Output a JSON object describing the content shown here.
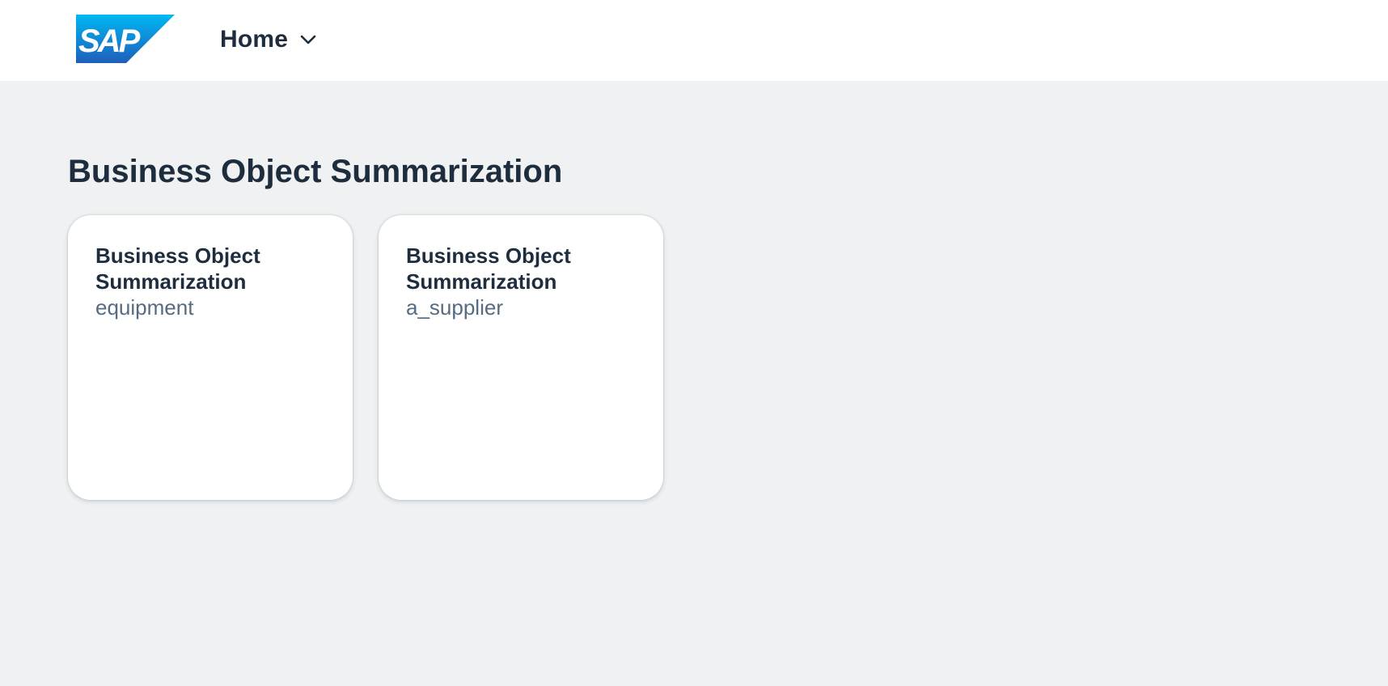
{
  "header": {
    "logo_text": "SAP",
    "menu_label": "Home",
    "menu_icon": "chevron-down-icon"
  },
  "main": {
    "section_title": "Business Object Summarization",
    "tiles": [
      {
        "title": "Business Object Summarization",
        "subtitle": "equipment"
      },
      {
        "title": "Business Object Summarization",
        "subtitle": "a_supplier"
      }
    ]
  },
  "colors": {
    "background": "#eff1f2",
    "header": "#ffffff",
    "text_primary": "#1d2d3e",
    "text_secondary": "#556b82",
    "brand_blue_light": "#00b8f1",
    "brand_blue_dark": "#1e5fbb"
  }
}
